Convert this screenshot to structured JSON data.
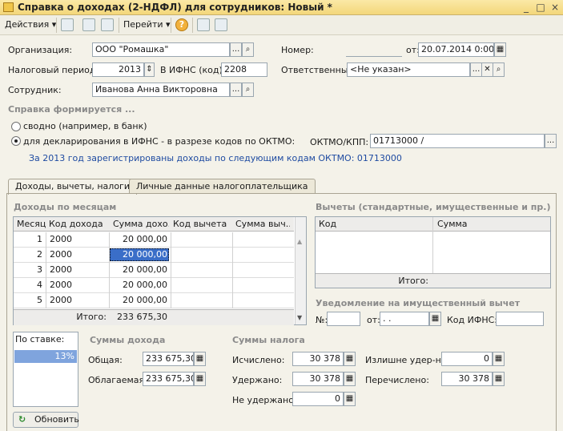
{
  "window": {
    "title": "Справка о доходах (2-НДФЛ) для сотрудников: Новый *",
    "min": "_",
    "max": "□",
    "close": "×"
  },
  "toolbar": {
    "actions": "Действия",
    "goto": "Перейти",
    "help": "?"
  },
  "form": {
    "org_label": "Организация:",
    "org_value": "ООО \"Ромашка\"",
    "number_label": "Номер:",
    "number_value": "",
    "from_label": "от:",
    "date_value": "20.07.2014  0:00:0",
    "period_label": "Налоговый период:",
    "period_value": "2013",
    "ifns_label": "В ИФНС (код):",
    "ifns_value": "2208",
    "resp_label": "Ответственный:",
    "resp_value": "<Не указан>",
    "emp_label": "Сотрудник:",
    "emp_value": "Иванова Анна Викторовна",
    "section_title": "Справка формируется ...",
    "radio1": "сводно (например, в банк)",
    "radio2": "для декларирования в ИФНС - в разрезе кодов по ОКТМО:",
    "oktmo_label": "ОКТМО/КПП:",
    "oktmo_value": "01713000   /",
    "info": "За 2013 год зарегистрированы доходы по следующим кодам ОКТМО: 01713000"
  },
  "tabs": [
    "Доходы, вычеты, налоги",
    "Личные данные налогоплательщика"
  ],
  "income": {
    "title": "Доходы по месяцам",
    "columns": [
      "Месяц",
      "Код дохода",
      "Сумма дохо...",
      "Код вычета",
      "Сумма выч..."
    ],
    "rows": [
      {
        "month": "1",
        "code": "2000",
        "sum": "20 000,00"
      },
      {
        "month": "2",
        "code": "2000",
        "sum": "20 000,00"
      },
      {
        "month": "3",
        "code": "2000",
        "sum": "20 000,00"
      },
      {
        "month": "4",
        "code": "2000",
        "sum": "20 000,00"
      },
      {
        "month": "5",
        "code": "2000",
        "sum": "20 000,00"
      }
    ],
    "total_label": "Итого:",
    "total_value": "233 675,30"
  },
  "deductions": {
    "title": "Вычеты (стандартные, имущественные и пр.)",
    "columns": [
      "Код",
      "Сумма"
    ],
    "total_label": "Итого:"
  },
  "notice": {
    "title": "Уведомление на имущественный вычет",
    "no_label": "№:",
    "from_label": "от:",
    "date_value": " .  .",
    "ifns_label": "Код ИФНС:"
  },
  "rate": {
    "header": "По ставке:",
    "value": "13%"
  },
  "sums": {
    "title": "Суммы дохода",
    "total_label": "Общая:",
    "total_value": "233 675,30",
    "taxable_label": "Облагаемая:",
    "taxable_value": "233 675,30"
  },
  "tax": {
    "title": "Суммы налога",
    "calc_label": "Исчислено:",
    "calc_value": "30 378",
    "held_label": "Удержано:",
    "held_value": "30 378",
    "not_held_label": "Не удержано:",
    "not_held_value": "0",
    "excess_label": "Излишне удер-но:",
    "excess_value": "0",
    "paid_label": "Перечислено:",
    "paid_value": "30 378"
  },
  "refresh": "Обновить"
}
